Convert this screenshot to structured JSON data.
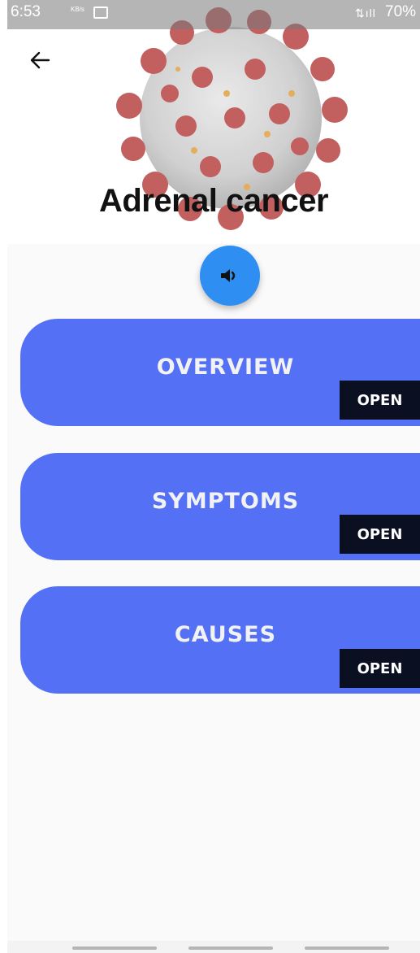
{
  "status_bar": {
    "time": "6:53",
    "speed": "KB/s",
    "battery": "70%"
  },
  "header": {
    "title": "Adrenal cancer",
    "back_icon": "arrow-left-icon",
    "image_icon": "coronavirus-image"
  },
  "sound_button": {
    "icon": "volume-icon",
    "color": "#2f8ef2"
  },
  "cards": [
    {
      "label": "OVERVIEW",
      "button": "OPEN"
    },
    {
      "label": "SYMPTOMS",
      "button": "OPEN"
    },
    {
      "label": "CAUSES",
      "button": "OPEN"
    }
  ],
  "colors": {
    "card": "#5470f5",
    "open_button": "#0b0f22",
    "background": "#fafafa"
  }
}
